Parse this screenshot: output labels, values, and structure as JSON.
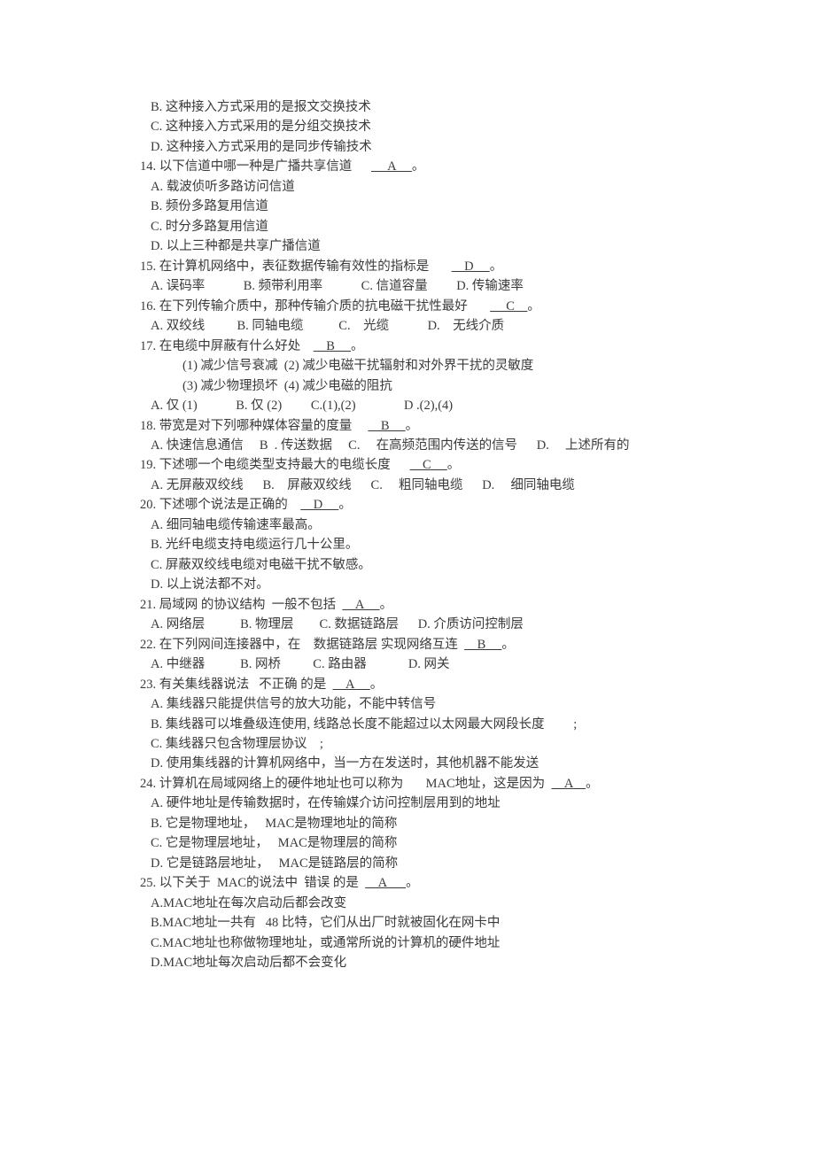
{
  "lines": [
    {
      "cls": "indent1",
      "segs": [
        {
          "t": "B. 这种接入方式采用的是报文交换技术"
        }
      ]
    },
    {
      "cls": "indent1",
      "segs": [
        {
          "t": "C. 这种接入方式采用的是分组交换技术"
        }
      ]
    },
    {
      "cls": "indent1",
      "segs": [
        {
          "t": "D. 这种接入方式采用的是同步传输技术"
        }
      ]
    },
    {
      "cls": "",
      "segs": [
        {
          "t": "14. 以下信道中哪一种是广播共享信道      "
        },
        {
          "t": "     A     ",
          "u": true
        },
        {
          "t": "。"
        }
      ]
    },
    {
      "cls": "indent1",
      "segs": [
        {
          "t": "A. 载波侦听多路访问信道"
        }
      ]
    },
    {
      "cls": "indent1",
      "segs": [
        {
          "t": "B. 频份多路复用信道"
        }
      ]
    },
    {
      "cls": "indent1",
      "segs": [
        {
          "t": "C. 时分多路复用信道"
        }
      ]
    },
    {
      "cls": "indent1",
      "segs": [
        {
          "t": "D. 以上三种都是共享广播信道"
        }
      ]
    },
    {
      "cls": "",
      "segs": [
        {
          "t": "15. 在计算机网络中，表征数据传输有效性的指标是       "
        },
        {
          "t": "    D     ",
          "u": true
        },
        {
          "t": "。"
        }
      ]
    },
    {
      "cls": "indent1",
      "segs": [
        {
          "t": "A. 误码率            B. 频带利用率            C. 信道容量         D. 传输速率"
        }
      ]
    },
    {
      "cls": "",
      "segs": [
        {
          "t": "16. 在下列传输介质中，那种传输介质的抗电磁干扰性最好       "
        },
        {
          "t": "     C    ",
          "u": true
        },
        {
          "t": "。"
        }
      ]
    },
    {
      "cls": "indent1",
      "segs": [
        {
          "t": "A. 双绞线          B. 同轴电缆           C.    光缆            D.    无线介质"
        }
      ]
    },
    {
      "cls": "",
      "segs": [
        {
          "t": "17. 在电缆中屏蔽有什么好处    "
        },
        {
          "t": "    B     ",
          "u": true
        },
        {
          "t": "。"
        }
      ]
    },
    {
      "cls": "indent2",
      "segs": [
        {
          "t": "(1) 减少信号衰减  (2) 减少电磁干扰辐射和对外界干扰的灵敏度"
        }
      ]
    },
    {
      "cls": "indent2",
      "segs": [
        {
          "t": "(3) 减少物理损坏  (4) 减少电磁的阻抗"
        }
      ]
    },
    {
      "cls": "indent1",
      "segs": [
        {
          "t": "A. 仅 (1)            B. 仅 (2)         C.(1),(2)               D .(2),(4)"
        }
      ]
    },
    {
      "cls": "",
      "segs": [
        {
          "t": "18. 带宽是对下列哪种媒体容量的度量     "
        },
        {
          "t": "    B     ",
          "u": true
        },
        {
          "t": "。"
        }
      ]
    },
    {
      "cls": "indent1",
      "segs": [
        {
          "t": "A. 快速信息通信     B  . 传送数据     C.     在高频范围内传送的信号      D.     上述所有的"
        }
      ]
    },
    {
      "cls": "",
      "segs": [
        {
          "t": "19. 下述哪一个电缆类型支持最大的电缆长度      "
        },
        {
          "t": "    C     ",
          "u": true
        },
        {
          "t": "。"
        }
      ]
    },
    {
      "cls": "indent1",
      "segs": [
        {
          "t": "A. 无屏蔽双绞线      B.    屏蔽双绞线      C.     粗同轴电缆      D.     细同轴电缆"
        }
      ]
    },
    {
      "cls": "",
      "segs": [
        {
          "t": "20. 下述哪个说法是正确的    "
        },
        {
          "t": "    D     ",
          "u": true
        },
        {
          "t": "。"
        }
      ]
    },
    {
      "cls": "indent1",
      "segs": [
        {
          "t": "A. 细同轴电缆传输速率最高。"
        }
      ]
    },
    {
      "cls": "indent1",
      "segs": [
        {
          "t": "B. 光纤电缆支持电缆运行几十公里。"
        }
      ]
    },
    {
      "cls": "indent1",
      "segs": [
        {
          "t": "C. 屏蔽双绞线电缆对电磁干扰不敏感。"
        }
      ]
    },
    {
      "cls": "indent1",
      "segs": [
        {
          "t": "D. 以上说法都不对。"
        }
      ]
    },
    {
      "cls": "",
      "segs": [
        {
          "t": "21. 局域网 的协议结构  一般不包括  "
        },
        {
          "t": "    A     ",
          "u": true
        },
        {
          "t": "。"
        }
      ]
    },
    {
      "cls": "indent1",
      "segs": [
        {
          "t": "A. 网络层           B. 物理层        C. 数据链路层      D. 介质访问控制层"
        }
      ]
    },
    {
      "cls": "",
      "segs": [
        {
          "t": "22. 在下列网间连接器中，在    数据链路层 实现网络互连  "
        },
        {
          "t": "    B     ",
          "u": true
        },
        {
          "t": "。"
        }
      ]
    },
    {
      "cls": "indent1",
      "segs": [
        {
          "t": "A. 中继器           B. 网桥          C. 路由器             D. 网关"
        }
      ]
    },
    {
      "cls": "",
      "segs": [
        {
          "t": "23. 有关集线器说法   不正确 的是  "
        },
        {
          "t": "    A     ",
          "u": true
        },
        {
          "t": "。"
        }
      ]
    },
    {
      "cls": "indent1",
      "segs": [
        {
          "t": "A. 集线器只能提供信号的放大功能，不能中转信号"
        }
      ]
    },
    {
      "cls": "indent1",
      "segs": [
        {
          "t": "B. 集线器可以堆叠级连使用, 线路总长度不能超过以太网最大网段长度         ;"
        }
      ]
    },
    {
      "cls": "indent1",
      "segs": [
        {
          "t": "C. 集线器只包含物理层协议    ;"
        }
      ]
    },
    {
      "cls": "indent1",
      "segs": [
        {
          "t": "D. 使用集线器的计算机网络中，当一方在发送时，其他机器不能发送"
        }
      ]
    },
    {
      "cls": "",
      "segs": [
        {
          "t": "24. 计算机在局域网络上的硬件地址也可以称为       MAC地址，这是因为  "
        },
        {
          "t": "    A    ",
          "u": true
        },
        {
          "t": "。"
        }
      ]
    },
    {
      "cls": "indent1",
      "segs": [
        {
          "t": "A. 硬件地址是传输数据时，在传输媒介访问控制层用到的地址"
        }
      ]
    },
    {
      "cls": "indent1",
      "segs": [
        {
          "t": "B. 它是物理地址，   MAC是物理地址的简称"
        }
      ]
    },
    {
      "cls": "indent1",
      "segs": [
        {
          "t": "C. 它是物理层地址，   MAC是物理层的简称"
        }
      ]
    },
    {
      "cls": "indent1",
      "segs": [
        {
          "t": "D. 它是链路层地址，   MAC是链路层的简称"
        }
      ]
    },
    {
      "cls": "",
      "segs": [
        {
          "t": "25. 以下关于  MAC的说法中  错误 的是  "
        },
        {
          "t": "    A      ",
          "u": true
        },
        {
          "t": "。"
        }
      ]
    },
    {
      "cls": "indent1",
      "segs": [
        {
          "t": "A.MAC地址在每次启动后都会改变"
        }
      ]
    },
    {
      "cls": "indent1",
      "segs": [
        {
          "t": "B.MAC地址一共有   48 比特，它们从出厂时就被固化在网卡中"
        }
      ]
    },
    {
      "cls": "indent1",
      "segs": [
        {
          "t": "C.MAC地址也称做物理地址，或通常所说的计算机的硬件地址"
        }
      ]
    },
    {
      "cls": "indent1",
      "segs": [
        {
          "t": "D.MAC地址每次启动后都不会变化"
        }
      ]
    }
  ]
}
